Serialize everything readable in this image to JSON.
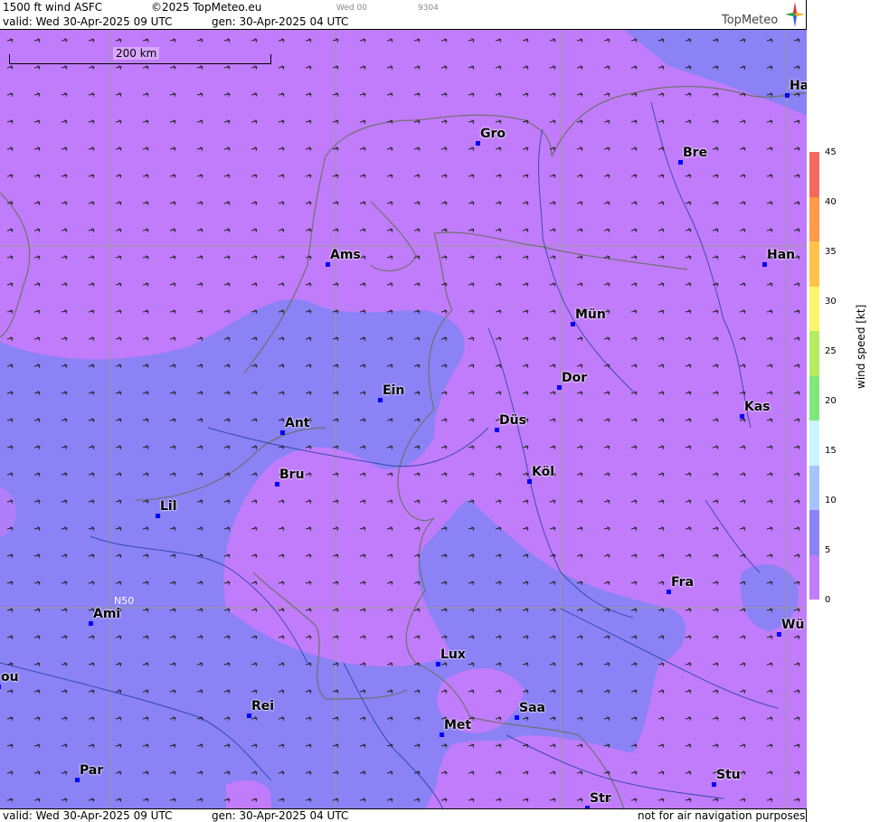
{
  "header": {
    "product": "1500 ft wind ASFC",
    "copyright": "©2025 TopMeteo.eu",
    "valid": "valid:  Wed  30-Apr-2025  09 UTC",
    "gen": "gen: 30-Apr-2025 04 UTC",
    "wed": "Wed 00",
    "code": "9304",
    "brand": "TopMeteo"
  },
  "footer": {
    "valid": "valid:  Wed  30-Apr-2025  09 UTC",
    "gen": "gen: 30-Apr-2025 04 UTC",
    "disclaimer": "not for air navigation purposes"
  },
  "map": {
    "scale_label": "200 km",
    "lat_label": "N50",
    "colors": {
      "speed_0_5": "#c07cfa",
      "speed_5_10": "#8a82f5",
      "coast": "#7a7a7a",
      "rivers": "#1f3fa0",
      "grid": "#9a9a9a"
    },
    "cities": [
      {
        "name": "Gro"
      },
      {
        "name": "Bre"
      },
      {
        "name": "Ha"
      },
      {
        "name": "Ams"
      },
      {
        "name": "Han"
      },
      {
        "name": "Mün"
      },
      {
        "name": "Dor"
      },
      {
        "name": "Ein"
      },
      {
        "name": "Kas"
      },
      {
        "name": "Ant"
      },
      {
        "name": "Düs"
      },
      {
        "name": "Bru"
      },
      {
        "name": "Köl"
      },
      {
        "name": "Lil"
      },
      {
        "name": "Fra"
      },
      {
        "name": "Ami"
      },
      {
        "name": "Wü"
      },
      {
        "name": "Lux"
      },
      {
        "name": "ou"
      },
      {
        "name": "Rei"
      },
      {
        "name": "Saa"
      },
      {
        "name": "Met"
      },
      {
        "name": "Par"
      },
      {
        "name": "Stu"
      },
      {
        "name": "Str"
      }
    ]
  },
  "legend": {
    "title": "wind speed  [kt]",
    "ticks": [
      "45",
      "40",
      "35",
      "30",
      "25",
      "20",
      "15",
      "10",
      "5",
      "0"
    ],
    "colors": [
      "#c07cfa",
      "#8a82f5",
      "#a7c4ff",
      "#c8f5ff",
      "#7fe87a",
      "#b3ec5e",
      "#fff36b",
      "#ffc24a",
      "#ff9a45",
      "#f46b5e"
    ]
  }
}
